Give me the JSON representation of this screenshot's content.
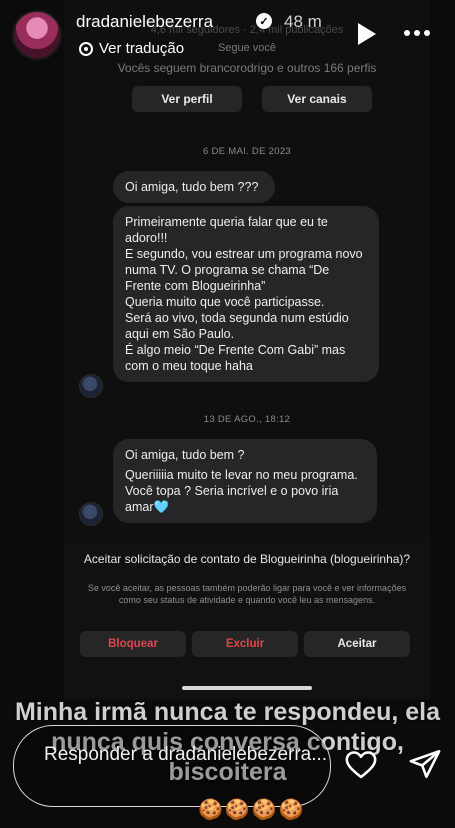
{
  "story": {
    "username": "dradanielebezerra",
    "time_ago": "48 m",
    "translate_label": "Ver tradução",
    "reply_placeholder": "Responder a dradanielebezerra...",
    "caption": "Minha irmã nunca te respondeu, ela nunca quis conversa contigo, biscoitera",
    "emojis": "🍪🍪🍪🍪"
  },
  "screenshot": {
    "profile": {
      "stats": "4,6 mil seguidores · 2,4 mil publicações",
      "follows_you": "Segue você",
      "mutuals": "Vocês seguem brancorodrigo e outros 166 perfis",
      "view_profile_label": "Ver perfil",
      "view_channels_label": "Ver canais"
    },
    "dates": [
      "6 DE MAI. DE 2023",
      "13 DE AGO., 18:12"
    ],
    "messages": [
      "Oi amiga, tudo bem ???",
      "Primeiramente queria falar que eu te adoro!!!\nE segundo, vou estrear um programa novo numa TV. O programa se chama “De Frente com Blogueirinha”\nQueria muito que você participasse.\nSerá ao vivo, toda segunda num estúdio aqui em São Paulo.\nÉ algo meio “De Frente Com Gabi” mas com o meu toque haha",
      "Oi amiga, tudo bem ?",
      "Queriiiiia muito te levar no meu programa. Você topa ? Seria incrível e o povo iria amar🩵"
    ],
    "request": {
      "title": "Aceitar solicitação de contato de Blogueirinha (blogueirinha)?",
      "body": "Se você aceitar, as pessoas também poderão ligar para você e ver informações como seu status de atividade e quando você leu as mensagens.",
      "block_label": "Bloquear",
      "delete_label": "Excluir",
      "accept_label": "Aceitar"
    }
  },
  "colors": {
    "danger": "#e0464e",
    "bubble": "#262628",
    "button": "#262626"
  },
  "icons": [
    "verified-icon",
    "translate-icon",
    "play-icon",
    "more-icon",
    "heart-icon",
    "send-icon"
  ]
}
